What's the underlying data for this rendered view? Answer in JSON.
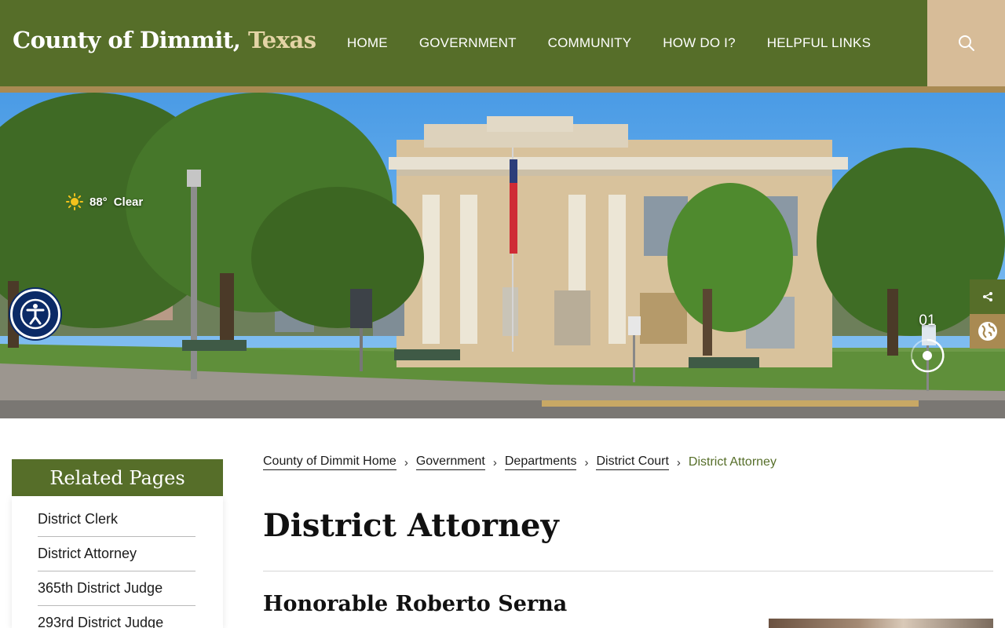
{
  "header": {
    "title_main": "County of Dimmit,",
    "title_accent": "Texas",
    "nav": [
      {
        "label": "HOME"
      },
      {
        "label": "GOVERNMENT"
      },
      {
        "label": "COMMUNITY"
      },
      {
        "label": "HOW DO I?"
      },
      {
        "label": "HELPFUL LINKS"
      }
    ],
    "search_icon": "search-icon"
  },
  "hero": {
    "weather": {
      "icon": "sun-icon",
      "temperature": "88°",
      "condition": "Clear"
    },
    "slide_number": "01",
    "accessibility_icon": "accessibility-icon",
    "share_icon": "share-icon",
    "translate_icon": "globe-icon"
  },
  "sidebar": {
    "heading": "Related Pages",
    "items": [
      {
        "label": "District Clerk"
      },
      {
        "label": "District Attorney"
      },
      {
        "label": "365th District Judge"
      },
      {
        "label": "293rd District Judge"
      }
    ]
  },
  "breadcrumb": [
    {
      "label": "County of Dimmit Home"
    },
    {
      "label": "Government"
    },
    {
      "label": "Departments"
    },
    {
      "label": "District Court"
    }
  ],
  "breadcrumb_current": "District Attorney",
  "main": {
    "title": "District Attorney",
    "subheading": "Honorable Roberto Serna"
  },
  "colors": {
    "brand_green": "#566e29",
    "accent_tan": "#a98a52",
    "search_tan": "#d7bc98",
    "title_accent": "#e4d4a6"
  }
}
